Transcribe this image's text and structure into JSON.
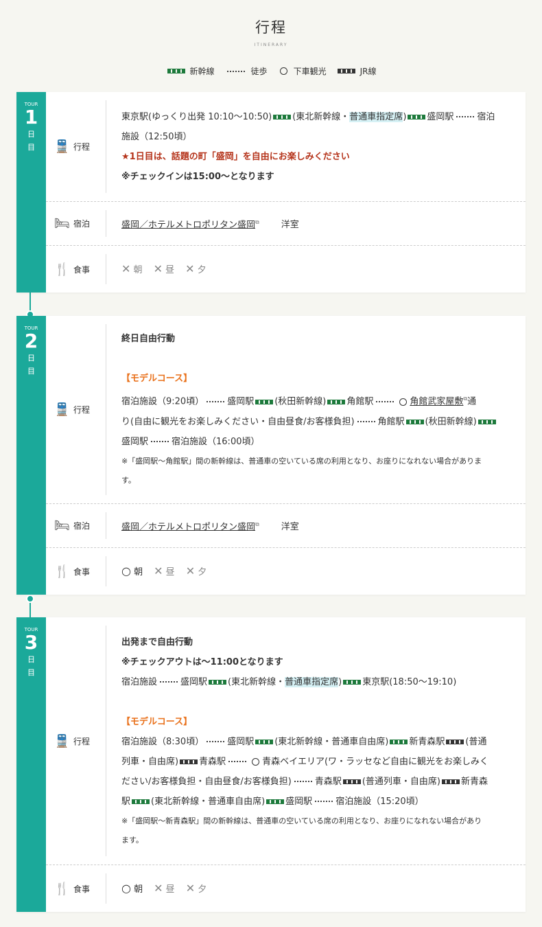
{
  "header": {
    "title": "行程",
    "subtitle": "ITINERARY"
  },
  "legend": [
    {
      "type": "shinkansen",
      "label": "新幹線"
    },
    {
      "type": "walk",
      "label": "徒歩"
    },
    {
      "type": "sightseeing",
      "label": "下車観光"
    },
    {
      "type": "jr",
      "label": "JR線"
    }
  ],
  "labels": {
    "tour": "TOUR",
    "day_kanji_1": "日",
    "day_kanji_2": "目",
    "itinerary": "行程",
    "stay": "宿泊",
    "meal": "食事",
    "room": "洋室"
  },
  "hotel": "盛岡／ホテルメトロポリタン盛岡",
  "meals": {
    "breakfast": "朝",
    "lunch": "昼",
    "dinner": "夕",
    "no": "✕",
    "yes": "○"
  },
  "days": [
    {
      "num": "1",
      "l1_a": "東京駅(ゆっくり出発 10:10～10:50)",
      "l1_b": "(東北新幹線・",
      "l1_hl": "普通車指定席",
      "l1_c": ")",
      "l1_d": "盛岡駅",
      "l1_e": "宿泊",
      "l2": "施設（12:50頃）",
      "red": "★1日目は、話題の町「盛岡」を自由にお楽しみください",
      "bold": "※チェックインは15:00～となります"
    },
    {
      "num": "2",
      "bold": "終日自由行動",
      "model": "【モデルコース】",
      "l1_a": "宿泊施設（9:20頃）",
      "l1_b": "盛岡駅",
      "l1_c": "(秋田新幹線)",
      "l1_d": "角館駅",
      "l1_link": "角館武家屋敷",
      "l1_e": "通",
      "l2_a": "り(自由に観光をお楽しみください・自由昼食/お客様負担)",
      "l2_b": "角館駅",
      "l2_c": "(秋田新幹線)",
      "l3_a": "盛岡駅",
      "l3_b": "宿泊施設（16:00頃）",
      "note1": "※「盛岡駅～角館駅」間の新幹線は、普通車の空いている席の利用となり、お座りになれない場合がありま",
      "note2": "す。"
    },
    {
      "num": "3",
      "bold1": "出発まで自由行動",
      "bold2": "※チェックアウトは～11:00となります",
      "l1_a": "宿泊施設",
      "l1_b": "盛岡駅",
      "l1_c": "(東北新幹線・",
      "l1_hl": "普通車指定席",
      "l1_d": ")",
      "l1_e": "東京駅(18:50～19:10)",
      "model": "【モデルコース】",
      "m1_a": "宿泊施設（8:30頃）",
      "m1_b": "盛岡駅",
      "m1_c": "(東北新幹線・普通車自由席)",
      "m1_d": "新青森駅",
      "m1_e": "(普通",
      "m2_a": "列車・自由席)",
      "m2_b": "青森駅",
      "m2_c": "青森ベイエリア(ワ・ラッセなど自由に観光をお楽しみく",
      "m3_a": "ださい/お客様負担・自由昼食/お客様負担)",
      "m3_b": "青森駅",
      "m3_c": "(普通列車・自由席)",
      "m3_d": "新青森",
      "m4_a": "駅",
      "m4_b": "(東北新幹線・普通車自由席)",
      "m4_c": "盛岡駅",
      "m4_d": "宿泊施設（15:20頃）",
      "note1": "※「盛岡駅～新青森駅」間の新幹線は、普通車の空いている席の利用となり、お座りになれない場合があり",
      "note2": "ます。"
    }
  ]
}
